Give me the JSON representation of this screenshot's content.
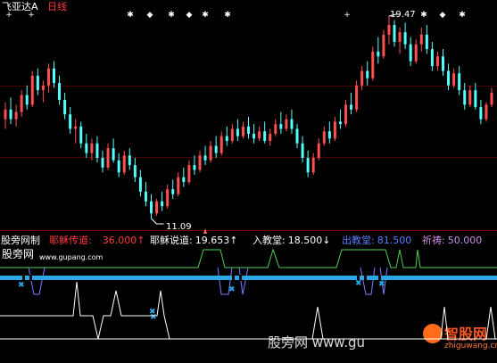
{
  "header": {
    "title": "飞亚达A",
    "period": "日线"
  },
  "price_labels": {
    "high": "19.47",
    "low": "11.09"
  },
  "indicator": {
    "name": "股旁网制",
    "values": [
      {
        "label": "耶稣传道:",
        "value": "36.000",
        "arrow": "↑",
        "color": "#ff3b3b"
      },
      {
        "label": "耶稣说道:",
        "value": "19.653",
        "arrow": "↑",
        "color": "#ffffff"
      },
      {
        "label": "入教堂:",
        "value": "18.500",
        "arrow": "↓",
        "color": "#ffffff"
      },
      {
        "label": "出教堂:",
        "value": "81.500",
        "arrow": "",
        "color": "#5a7dff"
      },
      {
        "label": "祈祷:",
        "value": "50.000",
        "arrow": "",
        "color": "#c98de6"
      }
    ],
    "site_name": "股旁网",
    "site_url": "www.gupang.com"
  },
  "watermarks": {
    "bottom_text": "股旁网 www.gu",
    "logo_text": "智股网",
    "logo_url": "zhiguwang.cn"
  },
  "colors": {
    "background": "#000000",
    "up_candle": "#ff5050",
    "down_candle": "#54ffff",
    "separator": "#7a0000",
    "green_line": "#4fcf4f",
    "blue_band": "#2aa8e8"
  },
  "chart_data": [
    {
      "type": "candlestick",
      "title": "飞亚达A 日线",
      "annotations": [
        {
          "text": "19.47",
          "kind": "high"
        },
        {
          "text": "11.09",
          "kind": "low"
        }
      ],
      "bars": [
        [
          15.2,
          15.9,
          14.8,
          15.6
        ],
        [
          15.6,
          16.1,
          15.0,
          15.2
        ],
        [
          15.2,
          15.8,
          14.9,
          15.5
        ],
        [
          15.5,
          16.4,
          15.3,
          16.2
        ],
        [
          16.2,
          16.6,
          15.6,
          15.8
        ],
        [
          15.8,
          17.2,
          15.7,
          17.0
        ],
        [
          17.0,
          17.3,
          16.2,
          16.4
        ],
        [
          16.4,
          16.8,
          15.9,
          16.6
        ],
        [
          16.6,
          17.5,
          16.3,
          17.3
        ],
        [
          17.3,
          17.6,
          16.5,
          16.7
        ],
        [
          16.7,
          17.0,
          15.8,
          16.0
        ],
        [
          16.0,
          16.3,
          15.2,
          15.4
        ],
        [
          15.4,
          15.7,
          14.6,
          14.8
        ],
        [
          14.8,
          15.2,
          14.2,
          14.9
        ],
        [
          14.9,
          15.1,
          14.0,
          14.2
        ],
        [
          14.2,
          14.6,
          13.6,
          13.8
        ],
        [
          13.8,
          14.4,
          13.5,
          14.2
        ],
        [
          14.2,
          14.5,
          13.4,
          13.6
        ],
        [
          13.6,
          13.9,
          13.0,
          13.2
        ],
        [
          13.2,
          14.2,
          13.1,
          14.0
        ],
        [
          14.0,
          14.4,
          13.4,
          13.5
        ],
        [
          13.5,
          13.8,
          12.8,
          13.0
        ],
        [
          13.0,
          13.9,
          12.9,
          13.7
        ],
        [
          13.7,
          14.0,
          13.1,
          13.3
        ],
        [
          13.3,
          13.6,
          12.6,
          12.8
        ],
        [
          12.8,
          13.1,
          12.0,
          12.2
        ],
        [
          12.2,
          12.6,
          11.6,
          11.8
        ],
        [
          11.8,
          12.1,
          11.09,
          11.3
        ],
        [
          11.3,
          11.9,
          11.2,
          11.8
        ],
        [
          11.8,
          12.2,
          11.4,
          11.6
        ],
        [
          11.6,
          12.5,
          11.5,
          12.3
        ],
        [
          12.3,
          12.7,
          11.9,
          12.1
        ],
        [
          12.1,
          13.0,
          12.0,
          12.8
        ],
        [
          12.8,
          13.2,
          12.4,
          12.6
        ],
        [
          12.6,
          13.5,
          12.5,
          13.3
        ],
        [
          13.3,
          13.7,
          12.9,
          13.1
        ],
        [
          13.1,
          13.9,
          13.0,
          13.7
        ],
        [
          13.7,
          14.1,
          13.3,
          13.5
        ],
        [
          13.5,
          14.3,
          13.4,
          14.1
        ],
        [
          14.1,
          14.5,
          13.6,
          13.8
        ],
        [
          13.8,
          14.7,
          13.7,
          14.5
        ],
        [
          14.5,
          14.9,
          14.1,
          14.3
        ],
        [
          14.3,
          15.0,
          14.2,
          14.8
        ],
        [
          14.8,
          15.2,
          14.3,
          14.5
        ],
        [
          14.5,
          15.1,
          14.4,
          14.9
        ],
        [
          14.9,
          15.3,
          14.4,
          14.6
        ],
        [
          14.6,
          15.0,
          14.2,
          14.4
        ],
        [
          14.4,
          14.9,
          14.3,
          14.7
        ],
        [
          14.7,
          15.1,
          14.2,
          14.3
        ],
        [
          14.3,
          14.8,
          14.1,
          14.6
        ],
        [
          14.6,
          15.2,
          14.5,
          15.0
        ],
        [
          15.0,
          15.5,
          14.6,
          14.8
        ],
        [
          14.8,
          15.4,
          14.7,
          15.2
        ],
        [
          15.2,
          15.6,
          14.6,
          14.8
        ],
        [
          14.8,
          15.0,
          14.0,
          14.2
        ],
        [
          14.2,
          14.5,
          13.4,
          13.6
        ],
        [
          13.6,
          13.9,
          12.8,
          13.0
        ],
        [
          13.0,
          13.8,
          12.9,
          13.6
        ],
        [
          13.6,
          14.4,
          13.5,
          14.2
        ],
        [
          14.2,
          14.9,
          14.1,
          14.7
        ],
        [
          14.7,
          15.1,
          14.2,
          14.4
        ],
        [
          14.4,
          15.3,
          14.3,
          15.1
        ],
        [
          15.1,
          15.6,
          14.8,
          15.0
        ],
        [
          15.0,
          16.0,
          14.9,
          15.8
        ],
        [
          15.8,
          16.3,
          15.4,
          15.6
        ],
        [
          15.6,
          16.8,
          15.5,
          16.6
        ],
        [
          16.6,
          17.4,
          16.4,
          17.2
        ],
        [
          17.2,
          17.6,
          16.6,
          16.9
        ],
        [
          16.9,
          18.2,
          16.8,
          18.0
        ],
        [
          18.0,
          18.6,
          17.5,
          17.8
        ],
        [
          17.8,
          18.9,
          17.7,
          18.7
        ],
        [
          18.7,
          19.47,
          18.3,
          19.1
        ],
        [
          19.1,
          19.3,
          18.2,
          18.4
        ],
        [
          18.4,
          19.0,
          17.9,
          18.8
        ],
        [
          18.8,
          19.2,
          18.1,
          18.3
        ],
        [
          18.3,
          18.6,
          17.4,
          17.6
        ],
        [
          17.6,
          18.5,
          17.5,
          18.3
        ],
        [
          18.3,
          19.0,
          18.0,
          18.7
        ],
        [
          18.7,
          19.1,
          17.9,
          18.1
        ],
        [
          18.1,
          18.4,
          17.2,
          17.4
        ],
        [
          17.4,
          18.0,
          17.2,
          17.8
        ],
        [
          17.8,
          18.1,
          17.0,
          17.2
        ],
        [
          17.2,
          17.5,
          16.4,
          16.6
        ],
        [
          16.6,
          17.3,
          16.5,
          17.1
        ],
        [
          17.1,
          17.4,
          16.2,
          16.4
        ],
        [
          16.4,
          16.7,
          15.6,
          15.8
        ],
        [
          15.8,
          16.6,
          15.7,
          16.4
        ],
        [
          16.4,
          16.7,
          15.6,
          15.7
        ],
        [
          15.7,
          16.0,
          15.0,
          15.2
        ],
        [
          15.2,
          15.9,
          15.1,
          15.8
        ],
        [
          15.8,
          16.5,
          15.7,
          16.3
        ]
      ]
    },
    {
      "type": "line",
      "title": "股旁网制",
      "series": [
        {
          "name": "耶稣传道",
          "value": 36.0
        },
        {
          "name": "耶稣说道",
          "value": 19.653
        },
        {
          "name": "入教堂",
          "value": 18.5
        },
        {
          "name": "出教堂",
          "value": 81.5
        },
        {
          "name": "祈祷",
          "value": 50.0
        }
      ]
    }
  ]
}
